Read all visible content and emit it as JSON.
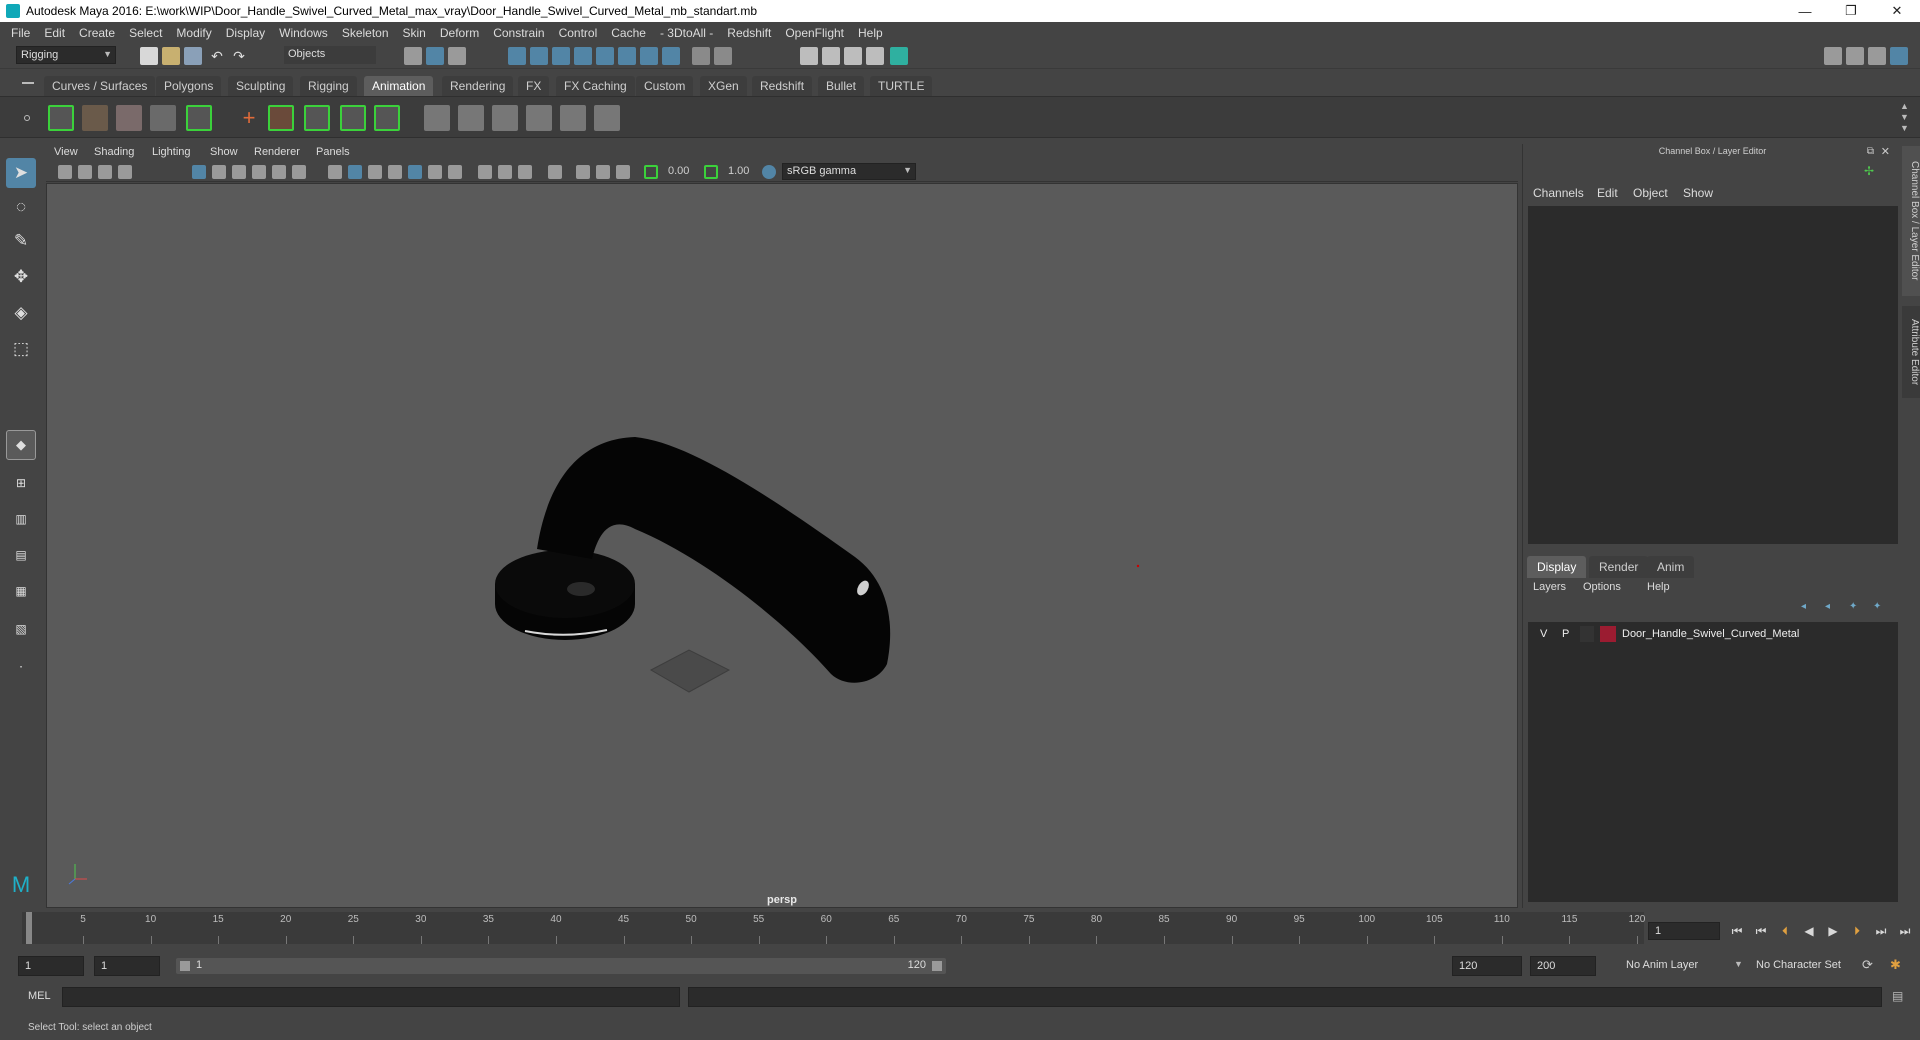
{
  "window": {
    "title": "Autodesk Maya 2016: E:\\work\\WIP\\Door_Handle_Swivel_Curved_Metal_max_vray\\Door_Handle_Swivel_Curved_Metal_mb_standart.mb",
    "minimize": "—",
    "maximize": "❐",
    "close": "✕"
  },
  "menus": [
    "File",
    "Edit",
    "Create",
    "Select",
    "Modify",
    "Display",
    "Windows",
    "Skeleton",
    "Skin",
    "Deform",
    "Constrain",
    "Control",
    "Cache",
    "- 3DtoAll -",
    "Redshift",
    "OpenFlight",
    "Help"
  ],
  "status": {
    "menuset": "Rigging",
    "selection_mode": "Objects"
  },
  "shelf": {
    "tabs": [
      "Curves / Surfaces",
      "Polygons",
      "Sculpting",
      "Rigging",
      "Animation",
      "Rendering",
      "FX",
      "FX Caching",
      "Custom",
      "XGen",
      "Redshift",
      "Bullet",
      "TURTLE"
    ],
    "active_tab": "Animation"
  },
  "viewport": {
    "menus": [
      "View",
      "Shading",
      "Lighting",
      "Show",
      "Renderer",
      "Panels"
    ],
    "exposure": "0.00",
    "gamma": "1.00",
    "colorspace": "sRGB gamma",
    "camera_label": "persp"
  },
  "channel_box": {
    "title": "Channel Box / Layer Editor",
    "menus": [
      "Channels",
      "Edit",
      "Object",
      "Show"
    ]
  },
  "layer_editor": {
    "tabs": [
      "Display",
      "Render",
      "Anim"
    ],
    "active_tab": "Display",
    "menus": [
      "Layers",
      "Options",
      "Help"
    ],
    "layers": [
      {
        "visible": "V",
        "playback": "P",
        "name": "Door_Handle_Swivel_Curved_Metal",
        "color": "#9b1c31"
      }
    ]
  },
  "side_tabs": [
    "Channel Box / Layer Editor",
    "Attribute Editor"
  ],
  "time_slider": {
    "ticks": [
      "5",
      "10",
      "15",
      "20",
      "25",
      "30",
      "35",
      "40",
      "45",
      "50",
      "55",
      "60",
      "65",
      "70",
      "75",
      "80",
      "85",
      "90",
      "95",
      "100",
      "105",
      "110",
      "115",
      "120"
    ],
    "start_tick": "1",
    "current_frame": "1"
  },
  "range": {
    "start": "1",
    "playback_start": "1",
    "range_start_label": "1",
    "range_end_label": "120",
    "playback_end": "120",
    "end": "200",
    "anim_layer": "No Anim Layer",
    "character_set": "No Character Set"
  },
  "command_line": {
    "label": "MEL"
  },
  "help_line": "Select Tool: select an object",
  "colors": {
    "accent": "#5285a6",
    "viewport_bg": "#5a5a5a"
  }
}
